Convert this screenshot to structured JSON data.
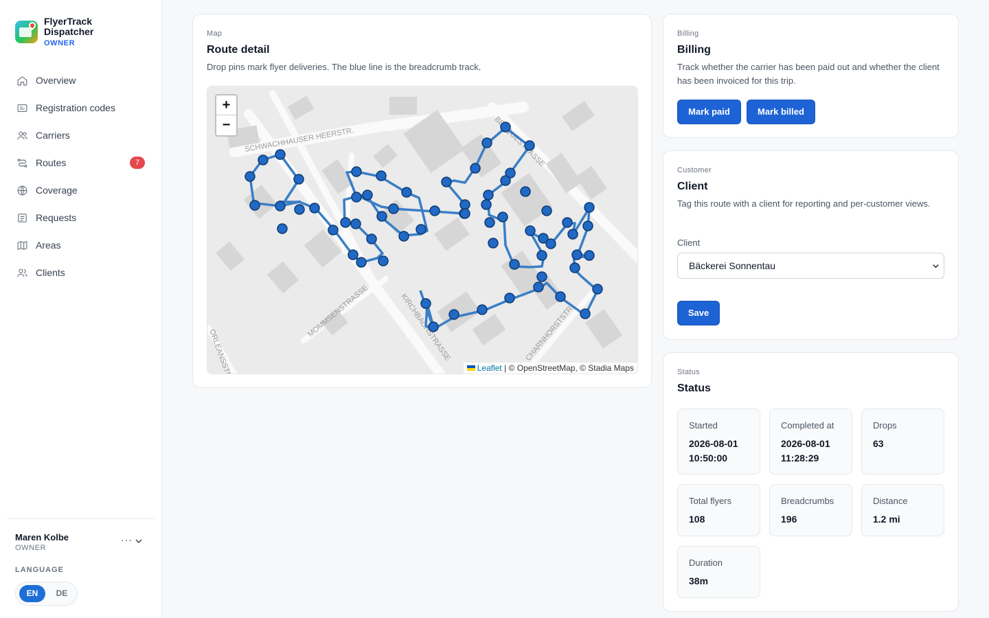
{
  "brand": {
    "name": "FlyerTrack Dispatcher",
    "role": "OWNER"
  },
  "nav": [
    {
      "label": "Overview",
      "icon": "home-icon"
    },
    {
      "label": "Registration codes",
      "icon": "id-card-icon"
    },
    {
      "label": "Carriers",
      "icon": "users-icon"
    },
    {
      "label": "Routes",
      "icon": "route-icon",
      "badge": "7"
    },
    {
      "label": "Coverage",
      "icon": "globe-icon"
    },
    {
      "label": "Requests",
      "icon": "document-icon"
    },
    {
      "label": "Areas",
      "icon": "map-icon"
    },
    {
      "label": "Clients",
      "icon": "clients-icon"
    }
  ],
  "user": {
    "name": "Maren Kolbe",
    "role": "OWNER",
    "more": "···"
  },
  "language": {
    "label": "LANGUAGE",
    "options": [
      "EN",
      "DE"
    ],
    "selected": "EN"
  },
  "map_card": {
    "eyebrow": "Map",
    "title": "Route detail",
    "description": "Drop pins mark flyer deliveries. The blue line is the breadcrumb track.",
    "zoom_in": "+",
    "zoom_out": "−",
    "attribution_link": "Leaflet",
    "attribution_text": "| © OpenStreetMap, © Stadia Maps",
    "street_labels": [
      "SCHWACHHAUSER HEERSTR.",
      "MOMMSENSTRASSE",
      "KIRCHBACHSTRASSE",
      "ORLEANSSTR.",
      "CHARNHORSTSTR.",
      "BENQUESTRASSE"
    ]
  },
  "billing": {
    "eyebrow": "Billing",
    "title": "Billing",
    "description": "Track whether the carrier has been paid out and whether the client has been invoiced for this trip.",
    "mark_paid": "Mark paid",
    "mark_billed": "Mark billed"
  },
  "client": {
    "eyebrow": "Customer",
    "title": "Client",
    "description": "Tag this route with a client for reporting and per-customer views.",
    "field_label": "Client",
    "selected": "Bäckerei Sonnentau",
    "save": "Save"
  },
  "status": {
    "eyebrow": "Status",
    "title": "Status",
    "stats": [
      {
        "label": "Started",
        "value": "2026-08-01 10:50:00"
      },
      {
        "label": "Completed at",
        "value": "2026-08-01 11:28:29"
      },
      {
        "label": "Drops",
        "value": "63"
      },
      {
        "label": "Total flyers",
        "value": "108"
      },
      {
        "label": "Breadcrumbs",
        "value": "196"
      },
      {
        "label": "Distance",
        "value": "1.2 mi"
      },
      {
        "label": "Duration",
        "value": "38m"
      }
    ]
  },
  "colors": {
    "accent": "#1d63d6",
    "track": "#3a7ec6",
    "badge": "#e5484d"
  }
}
